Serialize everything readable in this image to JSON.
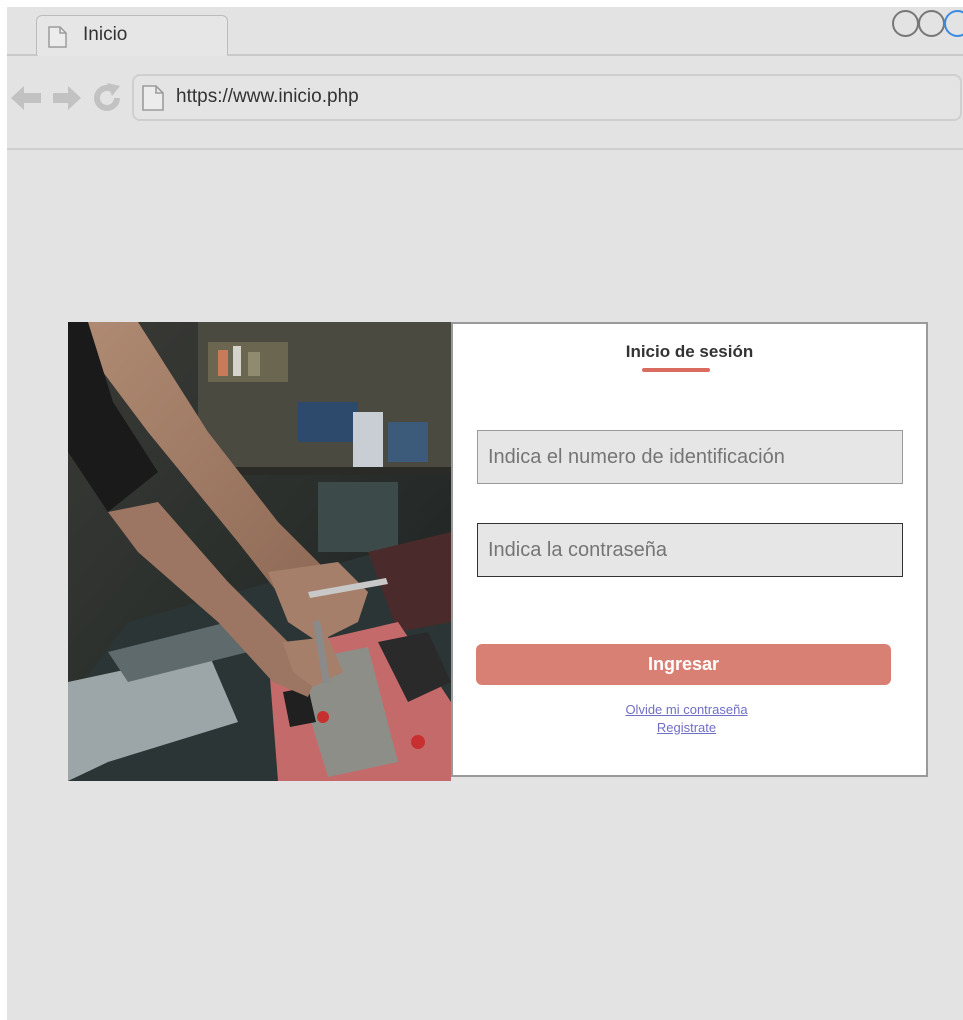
{
  "browser": {
    "tab_title": "Inicio",
    "url": "https://www.inicio.php",
    "icons": {
      "tab": "page-icon",
      "back": "back-arrow-icon",
      "forward": "forward-arrow-icon",
      "reload": "reload-icon",
      "address": "page-icon"
    },
    "window_controls": [
      "minimize",
      "maximize",
      "close"
    ]
  },
  "login": {
    "title": "Inicio de sesión",
    "id_placeholder": "Indica el numero de identificación",
    "password_placeholder": "Indica la contraseña",
    "submit_label": "Ingresar",
    "forgot_link": "Olvide mi contraseña",
    "register_link": "Registrate"
  },
  "colors": {
    "accent": "#d96b5f",
    "button": "#d98074",
    "link": "#6f6fc6",
    "background": "#e3e3e3"
  }
}
